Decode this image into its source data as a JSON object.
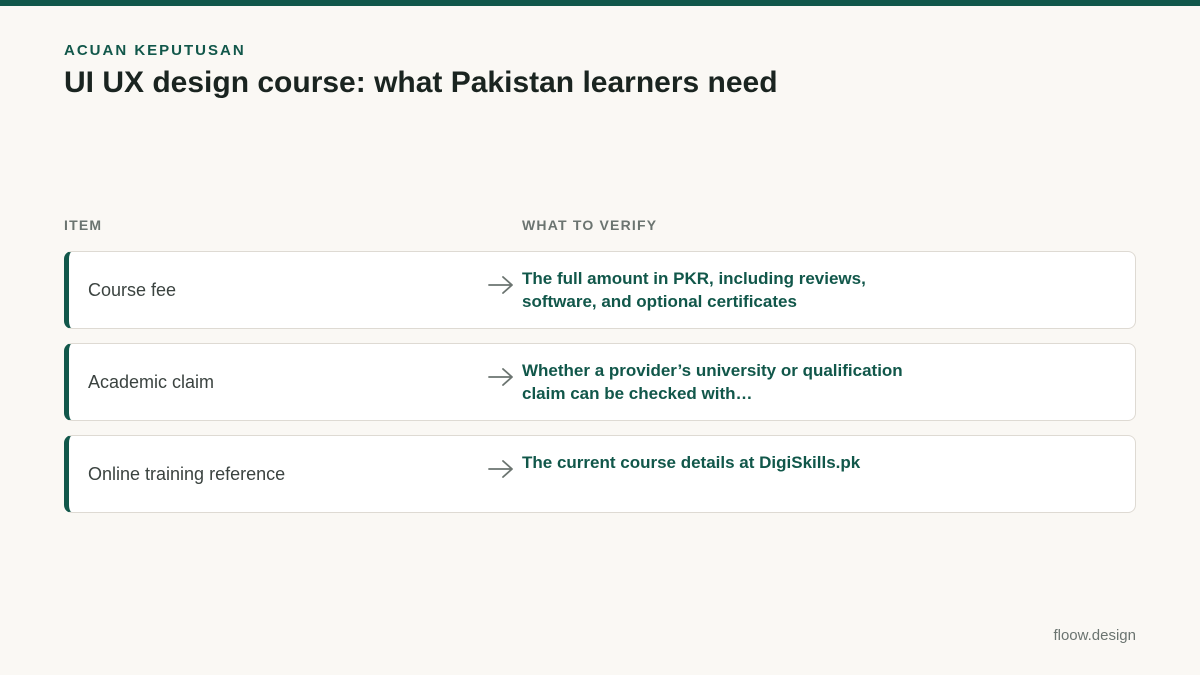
{
  "eyebrow": "ACUAN KEPUTUSAN",
  "title": "UI UX design course: what Pakistan learners need",
  "columns": {
    "item": "ITEM",
    "verify": "WHAT TO VERIFY"
  },
  "rows": [
    {
      "item": "Course fee",
      "verify": "The full amount in PKR, including reviews, software, and optional certificates"
    },
    {
      "item": "Academic claim",
      "verify": "Whether a provider’s university or qualification claim can be checked with…"
    },
    {
      "item": "Online training reference",
      "verify": "The current course details at DigiSkills.pk"
    }
  ],
  "icons": {
    "row_arrow": "arrow-right-icon"
  },
  "footer": "floow.design",
  "colors": {
    "accent": "#11574a",
    "background": "#faf8f4",
    "card": "#ffffff",
    "title": "#1a2420",
    "muted": "#6b7470"
  }
}
